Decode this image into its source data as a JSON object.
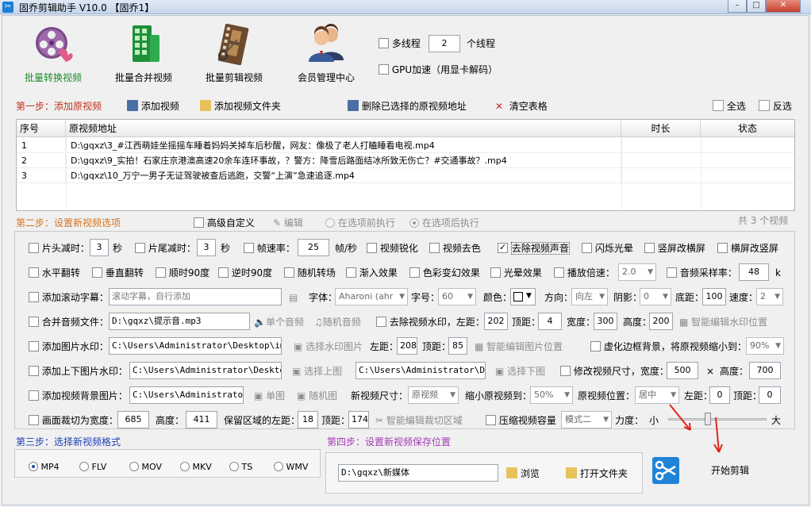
{
  "title": "固乔剪辑助手 V10.0  【固乔1】",
  "toolbar": {
    "items": [
      {
        "label": "批量转换视频",
        "active": true
      },
      {
        "label": "批量合并视频",
        "active": false
      },
      {
        "label": "批量剪辑视频",
        "active": false
      },
      {
        "label": "会员管理中心",
        "active": false
      }
    ],
    "multithread_label": "多线程",
    "thread_count": "2",
    "thread_unit": "个线程",
    "gpu_label": "GPU加速（用显卡解码）"
  },
  "step1": {
    "label": "第一步：添加原视频",
    "add_video": "添加视频",
    "add_folder": "添加视频文件夹",
    "delete_selected": "删除已选择的原视频地址",
    "clear_table": "清空表格",
    "select_all": "全选",
    "invert": "反选"
  },
  "table": {
    "columns": [
      "序号",
      "原视频地址",
      "时长",
      "状态"
    ],
    "rows": [
      {
        "no": "1",
        "path": "D:\\gqxz\\3_#江西萌娃坐摇摇车睡着妈妈关掉车后秒醒，网友：像极了老人打瞌睡看电视.mp4",
        "duration": "",
        "status": ""
      },
      {
        "no": "2",
        "path": "D:\\gqxz\\9_实拍！石家庄京港澳高速20余车连环事故，？警方：降雪后路面结冰所致无伤亡？#交通事故？.mp4",
        "duration": "",
        "status": ""
      },
      {
        "no": "3",
        "path": "D:\\gqxz\\10_万宁一男子无证驾驶被查后逃跑，交警“上演”急速追逐.mp4",
        "duration": "",
        "status": ""
      }
    ]
  },
  "step2": {
    "label": "第二步：设置新视频选项",
    "advanced": "高级自定义",
    "edit": "编辑",
    "before_exec": "在选项前执行",
    "after_exec": "在选项后执行",
    "count_text": "共 3 个视频"
  },
  "options": {
    "row1": {
      "head_cut": "片头减时：",
      "head_val": "3",
      "sec1": "秒",
      "tail_cut": "片尾减时：",
      "tail_val": "3",
      "sec2": "秒",
      "framerate": "帧速率：",
      "framerate_val": "25",
      "fps_unit": "帧/秒",
      "sharpen": "视频锐化",
      "decolor": "视频去色",
      "mute": "去除视频声音",
      "flash": "闪烁光晕",
      "v2h": "竖屏改横屏",
      "h2v": "横屏改竖屏"
    },
    "row2": {
      "hflip": "水平翻转",
      "vflip": "垂直翻转",
      "cw90": "顺时90度",
      "ccw90": "逆时90度",
      "random_trans": "随机转场",
      "fadein": "渐入效果",
      "color_fx": "色彩变幻效果",
      "halo": "光晕效果",
      "speed": "播放倍速：",
      "speed_val": "2.0",
      "samplerate": "音频采样率：",
      "samplerate_val": "48",
      "k": "k"
    },
    "row3": {
      "scroll_sub": "添加滚动字幕：",
      "scroll_placeholder": "滚动字幕，自行添加",
      "font": "字体：",
      "font_val": "Aharoni (ahr",
      "size": "字号：",
      "size_val": "60",
      "color": "颜色：",
      "direction": "方向：",
      "direction_val": "向左",
      "shadow": "阴影：",
      "shadow_val": "0",
      "bottom": "底距：",
      "bottom_val": "100",
      "speed": "速度：",
      "speed_val": "2"
    },
    "row4": {
      "merge_audio": "合并音频文件：",
      "audio_path": "D:\\gqxz\\提示音.mp3",
      "single_audio": "单个音频",
      "random_audio": "随机音频",
      "remove_wm": "去除视频水印，左距：",
      "left_val": "202",
      "top": "顶距：",
      "top_val": "4",
      "width": "宽度：",
      "width_val": "300",
      "height": "高度：",
      "height_val": "200",
      "smart_wm": "智能编辑水印位置"
    },
    "row5": {
      "img_wm": "添加图片水印：",
      "img_path": "C:\\Users\\Administrator\\Desktop\\img-q",
      "choose_img": "选择水印图片",
      "left": "左距：",
      "left_val": "208",
      "top": "顶距：",
      "top_val": "85",
      "smart_img": "智能编辑图片位置",
      "blur_border": "虚化边框背景，将原视频缩小到：",
      "blur_val": "90%"
    },
    "row6": {
      "updown_wm": "添加上下图片水印：",
      "up_path": "C:\\Users\\Administrator\\Desktop\\i",
      "choose_up": "选择上图",
      "down_path": "C:\\Users\\Administrator\\Desk",
      "choose_down": "选择下图",
      "resize": "修改视频尺寸，宽度：",
      "w_val": "500",
      "x": "×",
      "h_label": "高度：",
      "h_val": "700"
    },
    "row7": {
      "bg_img": "添加视频背景图片：",
      "bg_path": "C:\\Users\\Administrator\\D",
      "single_img": "单图",
      "random_img": "随机图",
      "new_size": "新视频尺寸：",
      "new_size_val": "原视频",
      "shrink": "缩小原视频到：",
      "shrink_val": "50%",
      "pos": "原视频位置：",
      "pos_val": "居中",
      "left": "左距：",
      "left_val": "0",
      "top": "顶距：",
      "top_val": "0"
    },
    "row8": {
      "crop": "画面裁切为宽度：",
      "crop_w": "685",
      "h": "高度：",
      "crop_h": "411",
      "keep_left": "保留区域的左距：",
      "keep_left_val": "18",
      "top": "顶距：",
      "top_val": "174",
      "smart_crop": "智能编辑裁切区域",
      "compress": "压缩视频容量",
      "mode_val": "模式二",
      "strength": "力度：",
      "small": "小",
      "large": "大",
      "strength_level": 0.4
    }
  },
  "step3": {
    "label": "第三步：选择新视频格式",
    "formats": [
      {
        "name": "MP4",
        "checked": true
      },
      {
        "name": "FLV",
        "checked": false
      },
      {
        "name": "MOV",
        "checked": false
      },
      {
        "name": "MKV",
        "checked": false
      },
      {
        "name": "TS",
        "checked": false
      },
      {
        "name": "WMV",
        "checked": false
      }
    ]
  },
  "step4": {
    "label": "第四步：设置新视频保存位置",
    "save_path": "D:\\gqxz\\新媒体",
    "browse": "浏览",
    "open_folder": "打开文件夹"
  },
  "start": "开始剪辑",
  "colors": {
    "accent_red": "#c0311e",
    "step_orange": "#d8731f",
    "step_purple": "#a23ab3",
    "active_green": "#1c8a2b",
    "arrow_red": "#e0261a"
  }
}
